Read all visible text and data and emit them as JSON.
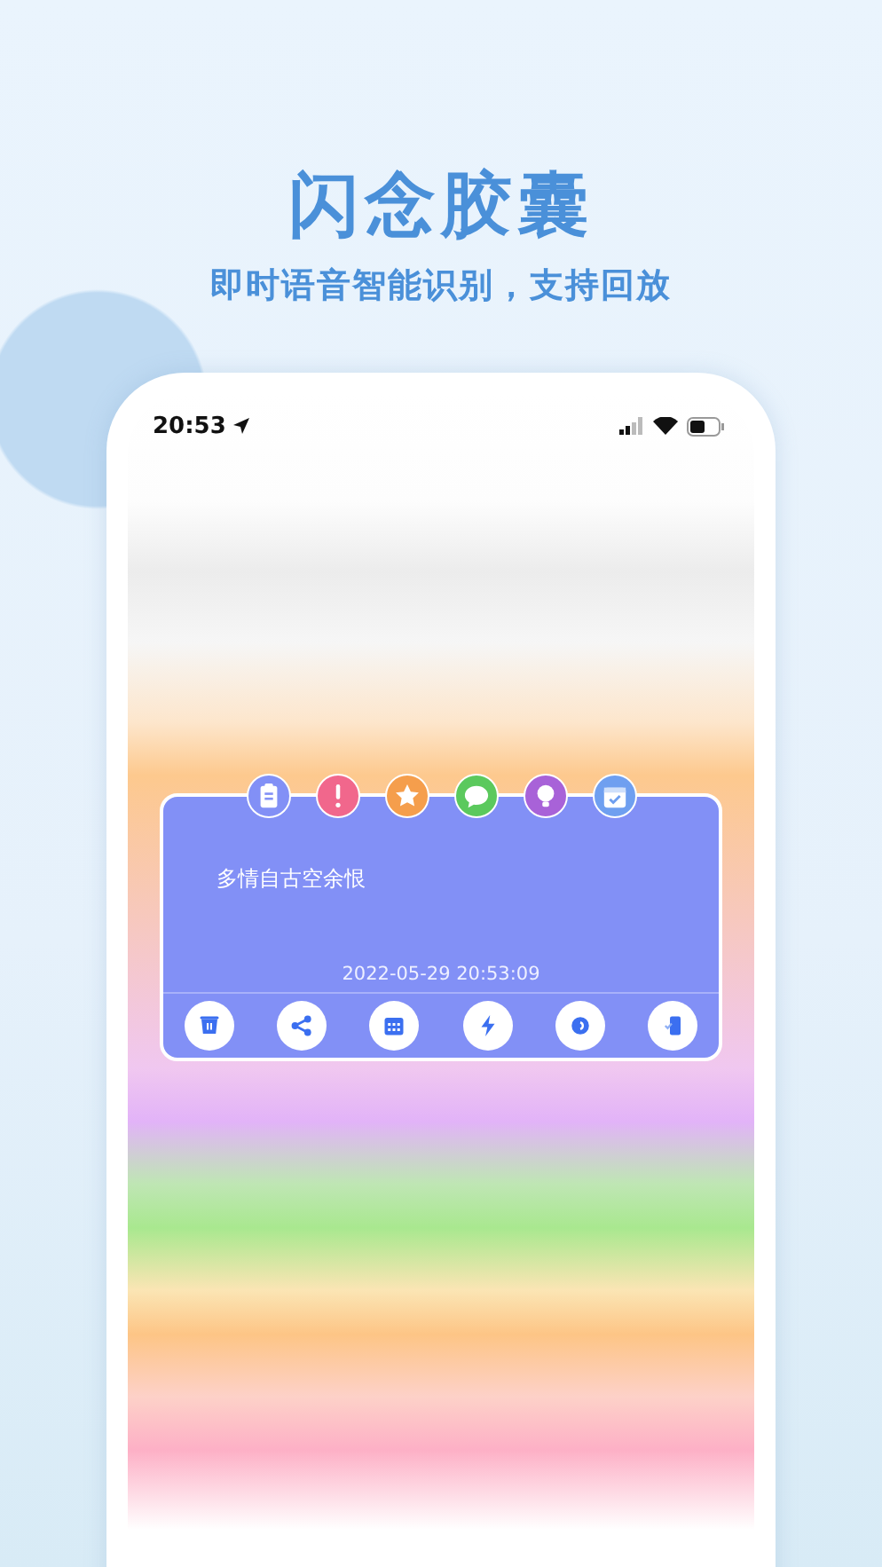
{
  "headline": "闪念胶囊",
  "tagline": "即时语音智能识别，支持回放",
  "status_bar": {
    "time": "20:53"
  },
  "categories": [
    {
      "color": "#8290f6"
    },
    {
      "color": "#f1678c"
    },
    {
      "color": "#f59e4c"
    },
    {
      "color": "#5bc95d"
    },
    {
      "color": "#a862d8"
    },
    {
      "color": "#6f9ff0"
    }
  ],
  "note": {
    "text": "多情自古空余恨",
    "timestamp": "2022-05-29 20:53:09"
  }
}
